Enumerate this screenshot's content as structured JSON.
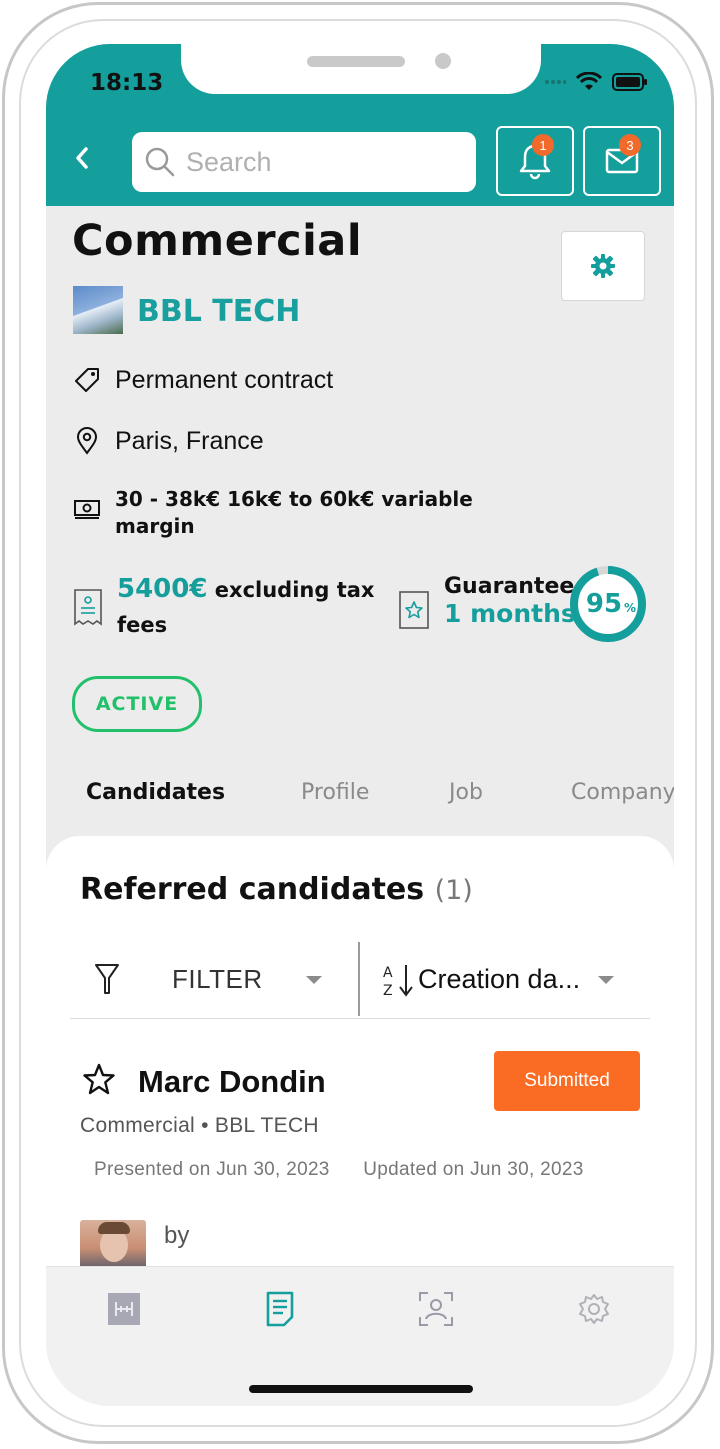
{
  "status_bar": {
    "time": "18:13"
  },
  "header": {
    "search_placeholder": "Search",
    "notifications_count": "1",
    "messages_count": "3",
    "brand_color": "#149e9c"
  },
  "job": {
    "title": "Commercial",
    "company": "BBL TECH",
    "contract": "Permanent contract",
    "location": "Paris, France",
    "salary": "30 - 38k€ 16k€ to 60k€ variable margin",
    "fee_amount": "5400€",
    "fee_text_1": "excluding tax",
    "fee_text_2": "fees",
    "guarantee_label": "Guarantee",
    "guarantee_value": "1 months",
    "score_number": "95",
    "score_unit": "%",
    "score_fraction": 0.95,
    "status": "ACTIVE"
  },
  "tabs": [
    {
      "label": "Candidates",
      "active": true
    },
    {
      "label": "Profile"
    },
    {
      "label": "Job"
    },
    {
      "label": "Company"
    }
  ],
  "referred": {
    "title": "Referred candidates",
    "count": "(1)",
    "filter_label": "FILTER",
    "sort_label": "Creation da..."
  },
  "candidate": {
    "name": "Marc Dondin",
    "status": "Submitted",
    "subtitle": "Commercial • BBL TECH",
    "presented": "Presented on Jun 30, 2023",
    "updated": "Updated on Jun 30, 2023",
    "by": "by"
  },
  "bottom_nav": [
    "dashboard-icon",
    "jobs-icon",
    "candidates-icon",
    "settings-icon"
  ]
}
